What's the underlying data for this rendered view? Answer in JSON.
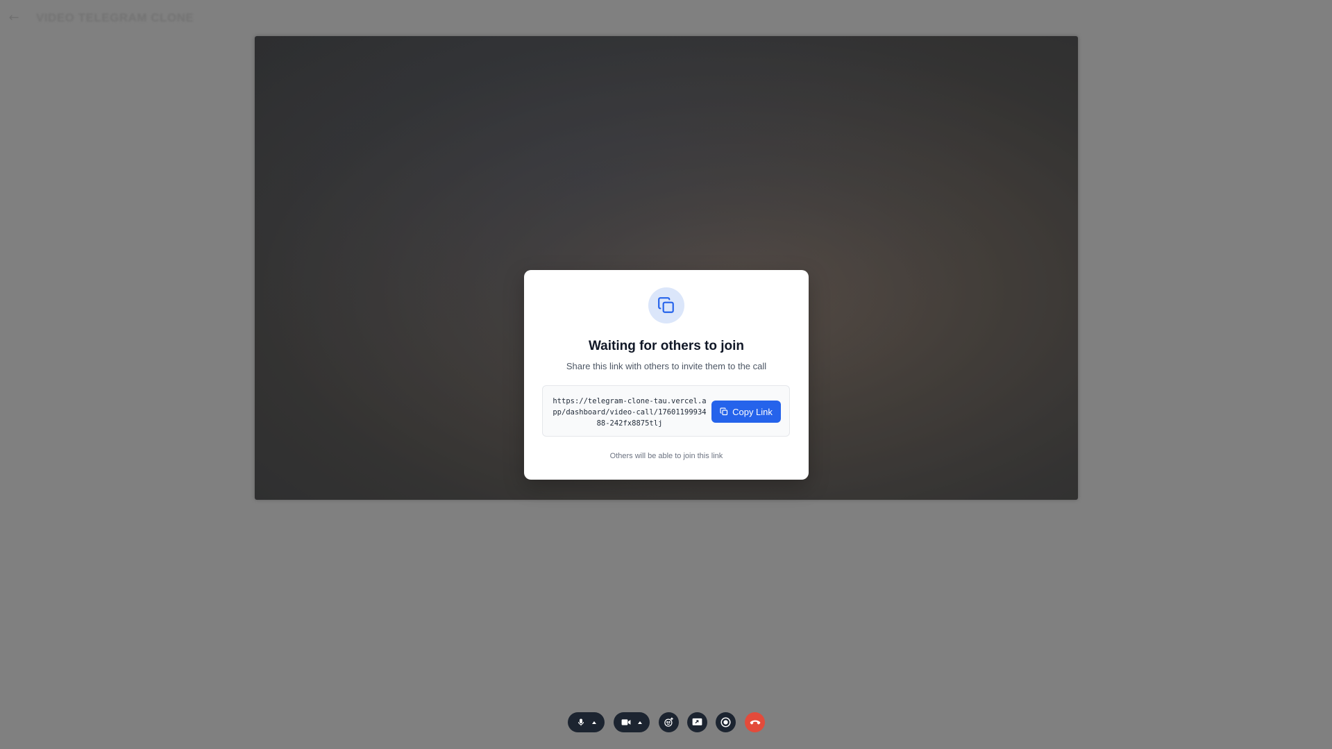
{
  "header": {
    "back_icon": "arrow-left-icon",
    "title": "VIDEO TELEGRAM CLONE"
  },
  "video": {
    "participant_label": ""
  },
  "modal": {
    "icon": "copy-icon",
    "title": "Waiting for others to join",
    "subtitle": "Share this link with others to invite them to the call",
    "link": "https://telegram-clone-tau.vercel.app/dashboard/video-call/1760119993488-242fx8875tlj",
    "copy_button_label": "Copy Link",
    "footnote": "Others will be able to join this link",
    "colors": {
      "accent": "#2563eb",
      "icon_bg": "#dbe6fa"
    }
  },
  "controls": {
    "items": [
      {
        "name": "microphone",
        "icon": "microphone-icon",
        "dropdown": true
      },
      {
        "name": "camera",
        "icon": "video-camera-icon",
        "dropdown": true
      },
      {
        "name": "reactions",
        "icon": "emoji-add-icon"
      },
      {
        "name": "screen-share",
        "icon": "screen-share-icon"
      },
      {
        "name": "record",
        "icon": "record-icon"
      },
      {
        "name": "end-call",
        "icon": "hang-up-icon"
      }
    ],
    "colors": {
      "button_bg": "#1c2430",
      "end_call": "#e34b3b"
    }
  }
}
